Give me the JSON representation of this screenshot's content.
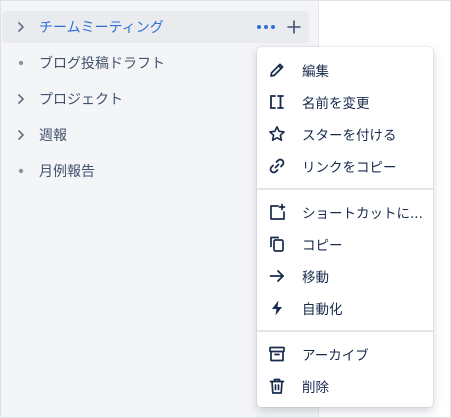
{
  "sidebar": {
    "rows": [
      {
        "label": "チームミーティング",
        "marker": "chevron-right"
      },
      {
        "label": "ブログ投稿ドラフト",
        "marker": "bullet"
      },
      {
        "label": "プロジェクト",
        "marker": "chevron-right"
      },
      {
        "label": "週報",
        "marker": "chevron-right"
      },
      {
        "label": "月例報告",
        "marker": "bullet"
      }
    ],
    "selected_index": 0
  },
  "context_menu": {
    "groups": [
      [
        {
          "label": "編集",
          "icon": "pencil-icon"
        },
        {
          "label": "名前を変更",
          "icon": "rename-cursor-icon"
        },
        {
          "label": "スターを付ける",
          "icon": "star-icon"
        },
        {
          "label": "リンクをコピー",
          "icon": "link-icon"
        }
      ],
      [
        {
          "label": "ショートカットに...",
          "icon": "add-shortcut-icon"
        },
        {
          "label": "コピー",
          "icon": "copy-icon"
        },
        {
          "label": "移動",
          "icon": "arrow-right-icon"
        },
        {
          "label": "自動化",
          "icon": "lightning-icon"
        }
      ],
      [
        {
          "label": "アーカイブ",
          "icon": "archive-icon"
        },
        {
          "label": "削除",
          "icon": "trash-icon"
        }
      ]
    ]
  },
  "colors": {
    "accent": "#2f6fdc",
    "text": "#172b4d",
    "muted": "#6b778c",
    "sidebar_bg": "#f4f5f7"
  }
}
